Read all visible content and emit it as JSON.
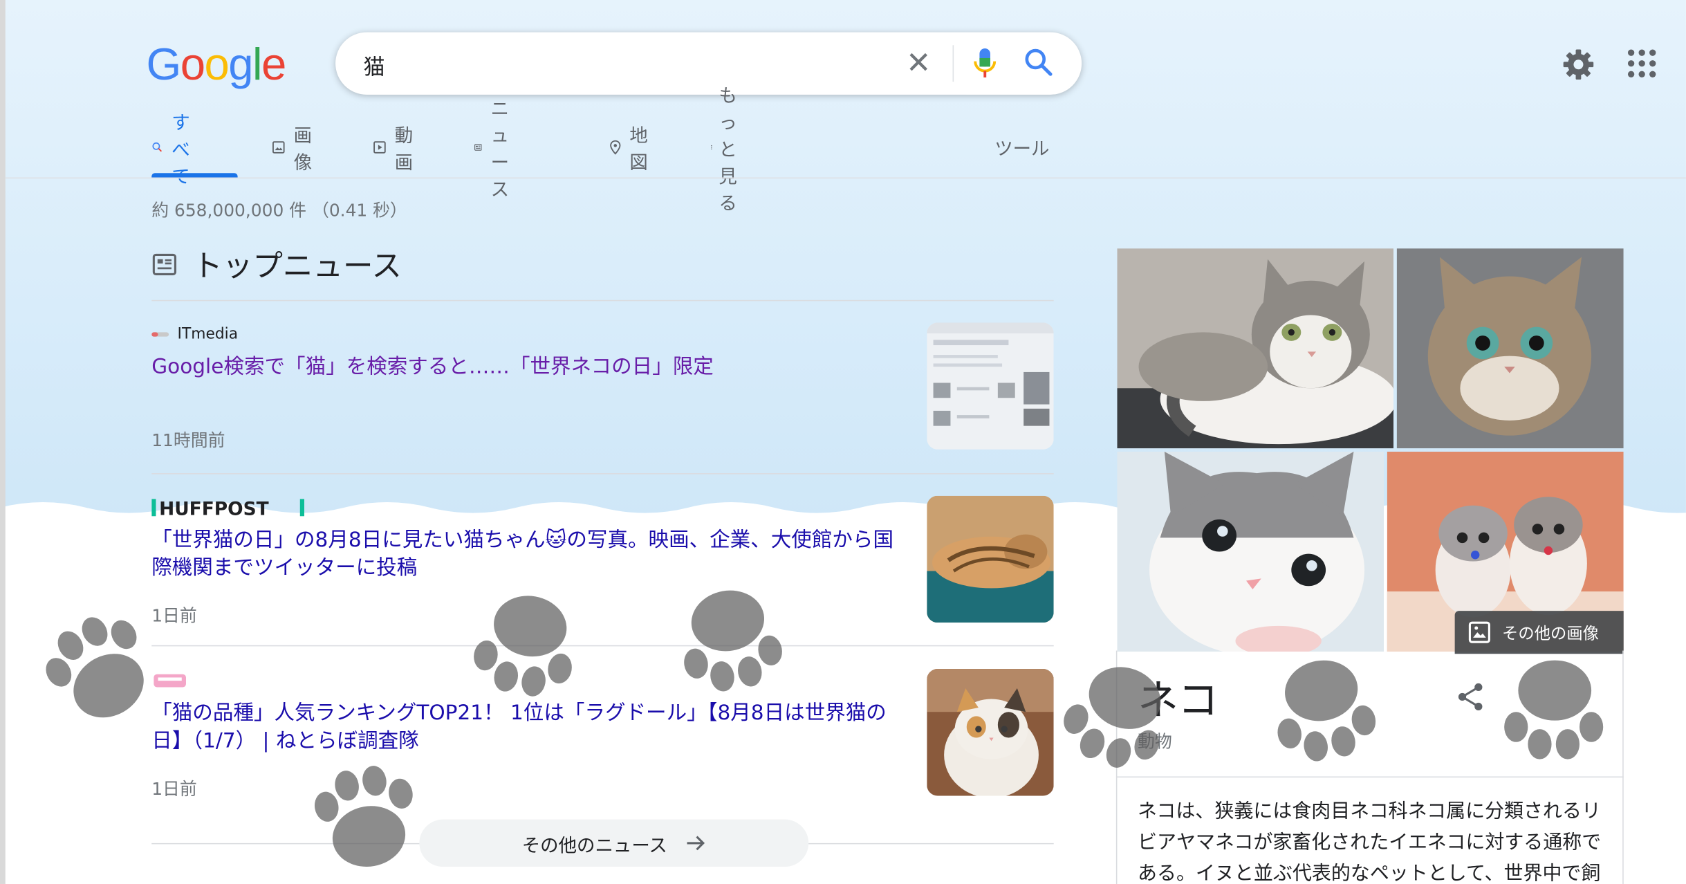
{
  "logo": {
    "letters": [
      "G",
      "o",
      "o",
      "g",
      "l",
      "e"
    ],
    "colors": [
      "#4285f4",
      "#ea4335",
      "#fbbc05",
      "#4285f4",
      "#34a853",
      "#ea4335"
    ]
  },
  "search": {
    "query": "猫"
  },
  "tabs": [
    {
      "label": "すべて",
      "icon": "search-icon",
      "active": true
    },
    {
      "label": "画像",
      "icon": "image-icon"
    },
    {
      "label": "動画",
      "icon": "video-icon"
    },
    {
      "label": "ニュース",
      "icon": "news-icon"
    },
    {
      "label": "地図",
      "icon": "map-pin-icon"
    },
    {
      "label": "もっと見る",
      "icon": "more-vert-icon"
    }
  ],
  "tools_label": "ツール",
  "result_stats": "約 658,000,000 件 （0.41 秒）",
  "top_news": {
    "title": "トップニュース",
    "items": [
      {
        "source": "ITmedia",
        "headline": "Google検索で「猫」を検索すると……「世界ネコの日」限定",
        "age": "11時間前"
      },
      {
        "source": "HUFFPOST",
        "headline": "「世界猫の日」の8月8日に見たい猫ちゃん🐱の写真。映画、企業、大使館から国際機関までツイッターに投稿",
        "age": "1日前"
      },
      {
        "source": "",
        "headline": "「猫の品種」人気ランキングTOP21！ 1位は「ラグドール」【8月8日は世界猫の日】（1/7） | ねとらぼ調査隊",
        "age": "1日前"
      }
    ],
    "more_label": "その他のニュース"
  },
  "knowledge_panel": {
    "more_images_label": "その他の画像",
    "title": "ネコ",
    "subtitle": "動物",
    "description": "ネコは、狭義には食肉目ネコ科ネコ属に分類されるリビアヤマネコが家畜化されたイエネコに対する通称である。イヌと並ぶ代表的なペットとして、世界中で飼"
  },
  "colors": {
    "accent": "#1a73e8",
    "visited_link": "#681da8",
    "link": "#1a0dab",
    "sky": "#d8ecfa"
  }
}
